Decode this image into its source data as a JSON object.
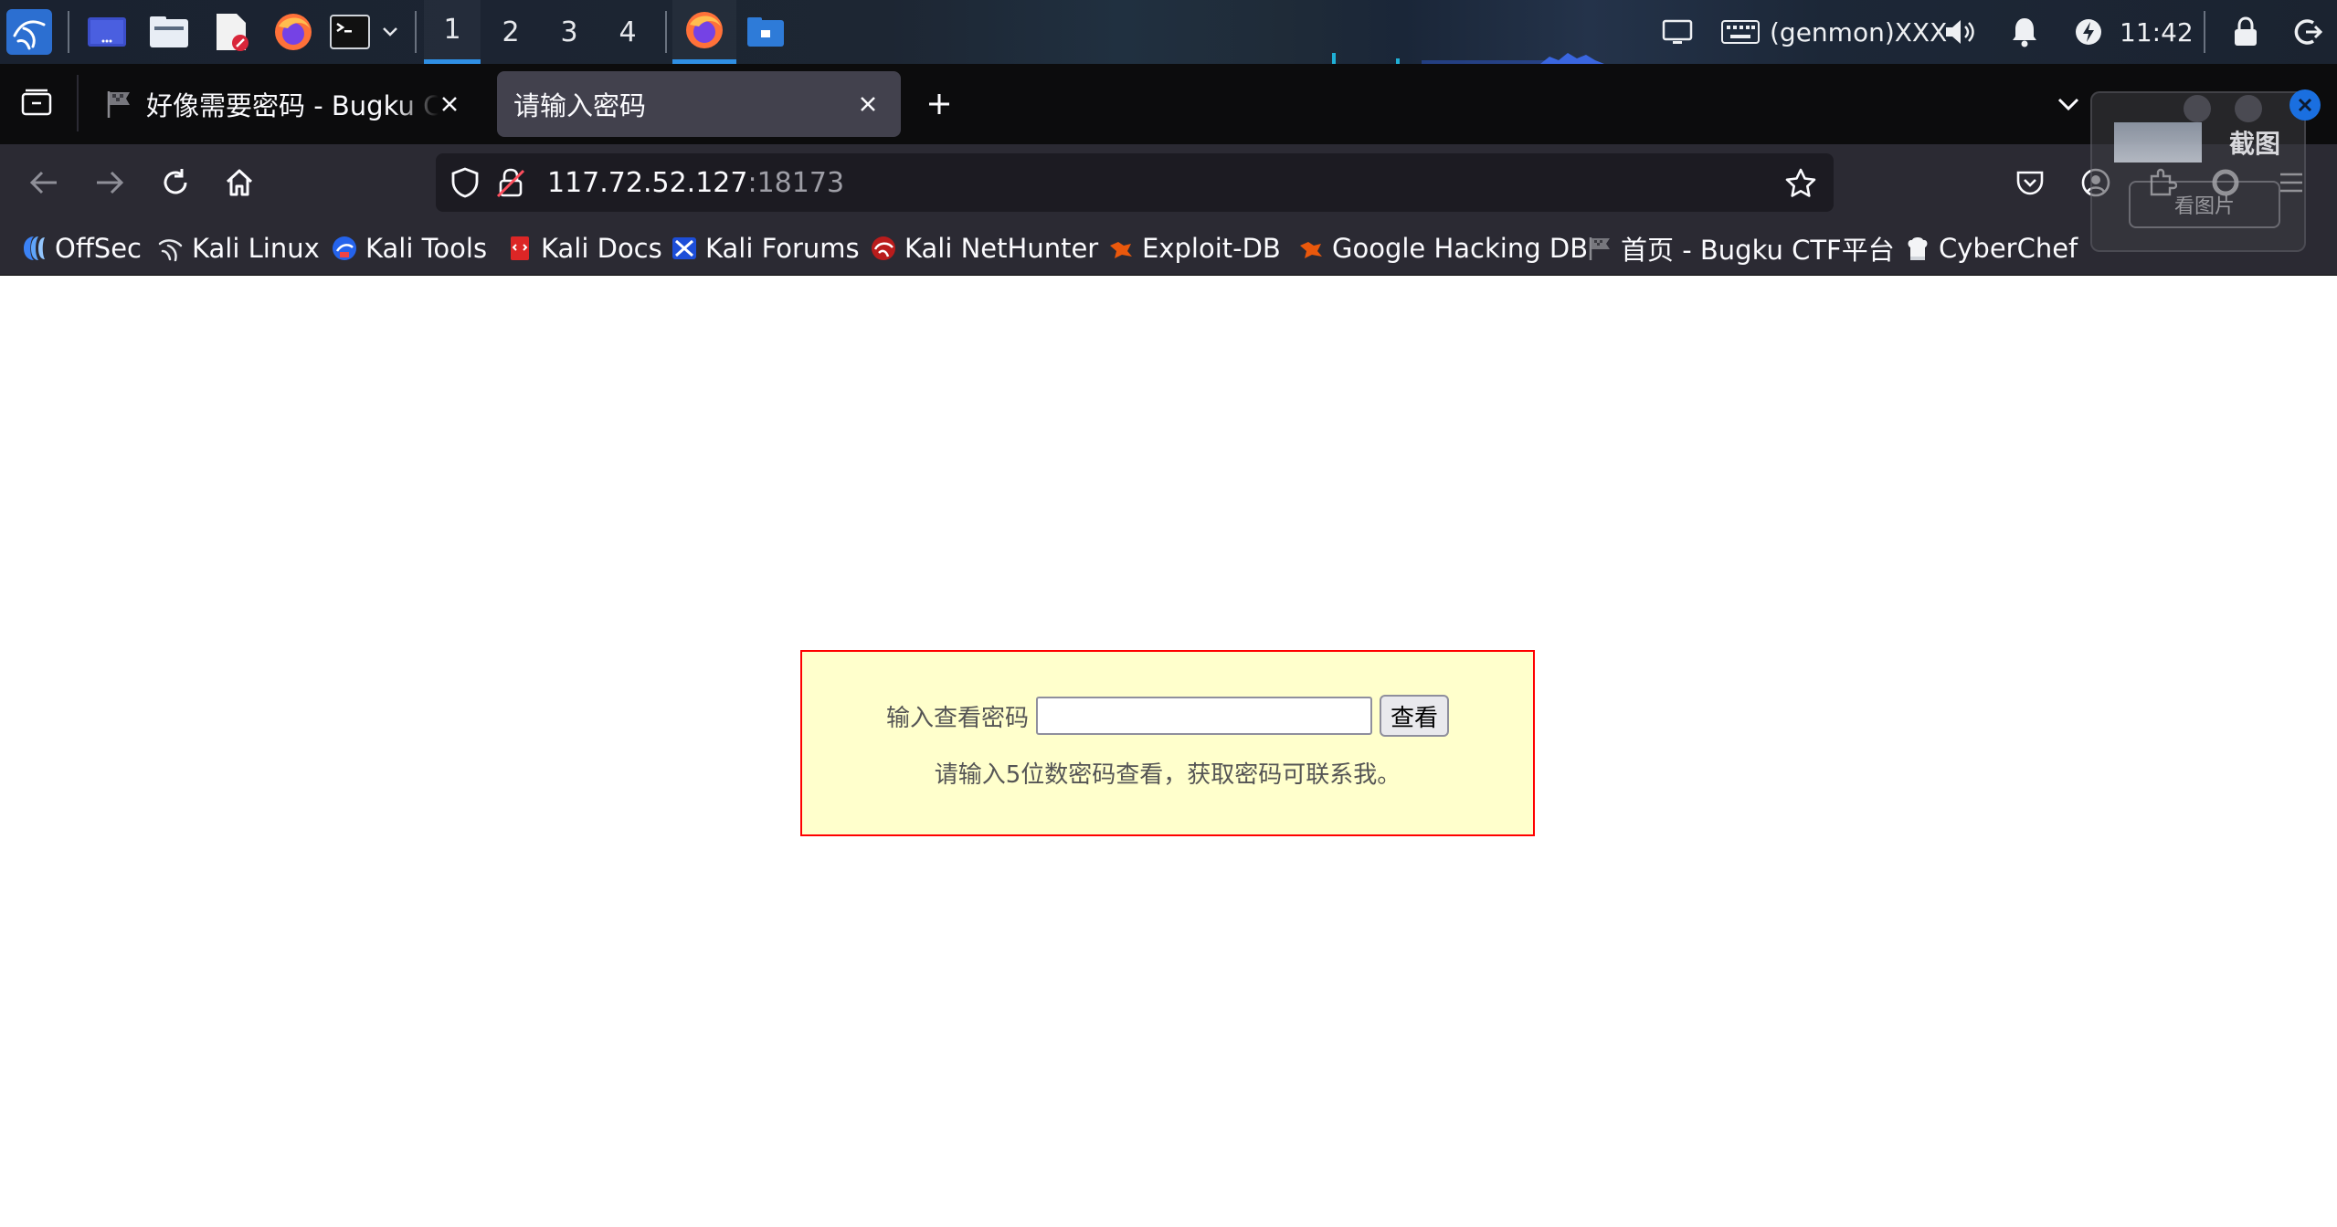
{
  "panel": {
    "workspaces": [
      "1",
      "2",
      "3",
      "4"
    ],
    "active_workspace": "1",
    "genmon_text": "(genmon)XXX",
    "clock": "11:42"
  },
  "tabs": [
    {
      "title": "好像需要密码 - Bugku CTF",
      "selected": false
    },
    {
      "title": "请输入密码",
      "selected": true
    }
  ],
  "url": {
    "host": "117.72.52.127",
    "port": ":18173"
  },
  "bookmarks": [
    {
      "label": "OffSec",
      "icon": "offsec-icon"
    },
    {
      "label": "Kali Linux",
      "icon": "kali-dragon-icon"
    },
    {
      "label": "Kali Tools",
      "icon": "kali-tools-icon"
    },
    {
      "label": "Kali Docs",
      "icon": "kali-docs-icon"
    },
    {
      "label": "Kali Forums",
      "icon": "kali-forums-icon"
    },
    {
      "label": "Kali NetHunter",
      "icon": "nethunter-icon"
    },
    {
      "label": "Exploit-DB",
      "icon": "exploitdb-icon"
    },
    {
      "label": "Google Hacking DB",
      "icon": "ghdb-icon"
    },
    {
      "label": "首页 - Bugku CTF平台",
      "icon": "bugku-flag-icon"
    },
    {
      "label": "CyberChef",
      "icon": "cyberchef-icon"
    }
  ],
  "screenshot_widget": {
    "title": "截图",
    "button": "看图片"
  },
  "form": {
    "label": "输入查看密码",
    "input_value": "",
    "submit_label": "查看",
    "hint": "请输入5位数密码查看，获取密码可联系我。"
  },
  "colors": {
    "panel_bg": "#1b2330",
    "tab_strip_bg": "#0c0c0d",
    "toolbar_bg": "#2b2a33",
    "urlbar_bg": "#1c1b22",
    "box_bg": "#ffffcc",
    "box_border": "#ff0000",
    "workspace_accent": "#2f8fe4"
  }
}
